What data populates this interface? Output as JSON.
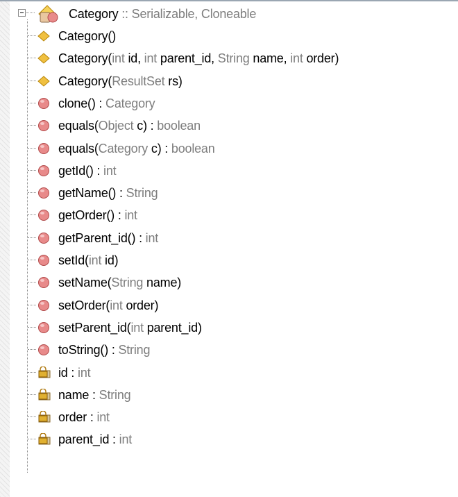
{
  "root": {
    "name": "Category",
    "sep": " :: ",
    "interfaces": "Serializable, Cloneable"
  },
  "colors": {
    "constructor_icon": "#f0c040",
    "method_icon": "#e88a8a",
    "field_icon": "#e0b030",
    "type_text": "#7d7d7d"
  },
  "items": [
    {
      "kind": "constructor",
      "icon": "diamond-icon",
      "parts": [
        {
          "t": "Category()",
          "c": "n"
        }
      ]
    },
    {
      "kind": "constructor",
      "icon": "diamond-icon",
      "parts": [
        {
          "t": "Category(",
          "c": "n"
        },
        {
          "t": "int ",
          "c": "g"
        },
        {
          "t": "id, ",
          "c": "n"
        },
        {
          "t": "int ",
          "c": "g"
        },
        {
          "t": "parent_id, ",
          "c": "n"
        },
        {
          "t": "String ",
          "c": "g"
        },
        {
          "t": "name, ",
          "c": "n"
        },
        {
          "t": "int ",
          "c": "g"
        },
        {
          "t": "order)",
          "c": "n"
        }
      ]
    },
    {
      "kind": "constructor",
      "icon": "diamond-icon",
      "parts": [
        {
          "t": "Category(",
          "c": "n"
        },
        {
          "t": "ResultSet ",
          "c": "g"
        },
        {
          "t": "rs)",
          "c": "n"
        }
      ]
    },
    {
      "kind": "method",
      "icon": "method-circle-icon",
      "parts": [
        {
          "t": "clone() : ",
          "c": "n"
        },
        {
          "t": "Category",
          "c": "g"
        }
      ]
    },
    {
      "kind": "method",
      "icon": "method-circle-icon",
      "parts": [
        {
          "t": "equals(",
          "c": "n"
        },
        {
          "t": "Object ",
          "c": "g"
        },
        {
          "t": "c) : ",
          "c": "n"
        },
        {
          "t": "boolean",
          "c": "g"
        }
      ]
    },
    {
      "kind": "method",
      "icon": "method-circle-icon",
      "parts": [
        {
          "t": "equals(",
          "c": "n"
        },
        {
          "t": "Category ",
          "c": "g"
        },
        {
          "t": "c) : ",
          "c": "n"
        },
        {
          "t": "boolean",
          "c": "g"
        }
      ]
    },
    {
      "kind": "method",
      "icon": "method-circle-icon",
      "parts": [
        {
          "t": "getId() : ",
          "c": "n"
        },
        {
          "t": "int",
          "c": "g"
        }
      ]
    },
    {
      "kind": "method",
      "icon": "method-circle-icon",
      "parts": [
        {
          "t": "getName() : ",
          "c": "n"
        },
        {
          "t": "String",
          "c": "g"
        }
      ]
    },
    {
      "kind": "method",
      "icon": "method-circle-icon",
      "parts": [
        {
          "t": "getOrder() : ",
          "c": "n"
        },
        {
          "t": "int",
          "c": "g"
        }
      ]
    },
    {
      "kind": "method",
      "icon": "method-circle-icon",
      "parts": [
        {
          "t": "getParent_id() : ",
          "c": "n"
        },
        {
          "t": "int",
          "c": "g"
        }
      ]
    },
    {
      "kind": "method",
      "icon": "method-circle-icon",
      "parts": [
        {
          "t": "setId(",
          "c": "n"
        },
        {
          "t": "int ",
          "c": "g"
        },
        {
          "t": "id)",
          "c": "n"
        }
      ]
    },
    {
      "kind": "method",
      "icon": "method-circle-icon",
      "parts": [
        {
          "t": "setName(",
          "c": "n"
        },
        {
          "t": "String ",
          "c": "g"
        },
        {
          "t": "name)",
          "c": "n"
        }
      ]
    },
    {
      "kind": "method",
      "icon": "method-circle-icon",
      "parts": [
        {
          "t": "setOrder(",
          "c": "n"
        },
        {
          "t": "int ",
          "c": "g"
        },
        {
          "t": "order)",
          "c": "n"
        }
      ]
    },
    {
      "kind": "method",
      "icon": "method-circle-icon",
      "parts": [
        {
          "t": "setParent_id(",
          "c": "n"
        },
        {
          "t": "int ",
          "c": "g"
        },
        {
          "t": "parent_id)",
          "c": "n"
        }
      ]
    },
    {
      "kind": "method",
      "icon": "method-circle-icon",
      "parts": [
        {
          "t": "toString() : ",
          "c": "n"
        },
        {
          "t": "String",
          "c": "g"
        }
      ]
    },
    {
      "kind": "field",
      "icon": "private-field-lock-icon",
      "parts": [
        {
          "t": "id : ",
          "c": "n"
        },
        {
          "t": "int",
          "c": "g"
        }
      ]
    },
    {
      "kind": "field",
      "icon": "private-field-lock-icon",
      "parts": [
        {
          "t": "name : ",
          "c": "n"
        },
        {
          "t": "String",
          "c": "g"
        }
      ]
    },
    {
      "kind": "field",
      "icon": "private-field-lock-icon",
      "parts": [
        {
          "t": "order : ",
          "c": "n"
        },
        {
          "t": "int",
          "c": "g"
        }
      ]
    },
    {
      "kind": "field",
      "icon": "private-field-lock-icon",
      "parts": [
        {
          "t": "parent_id : ",
          "c": "n"
        },
        {
          "t": "int",
          "c": "g"
        }
      ]
    }
  ]
}
